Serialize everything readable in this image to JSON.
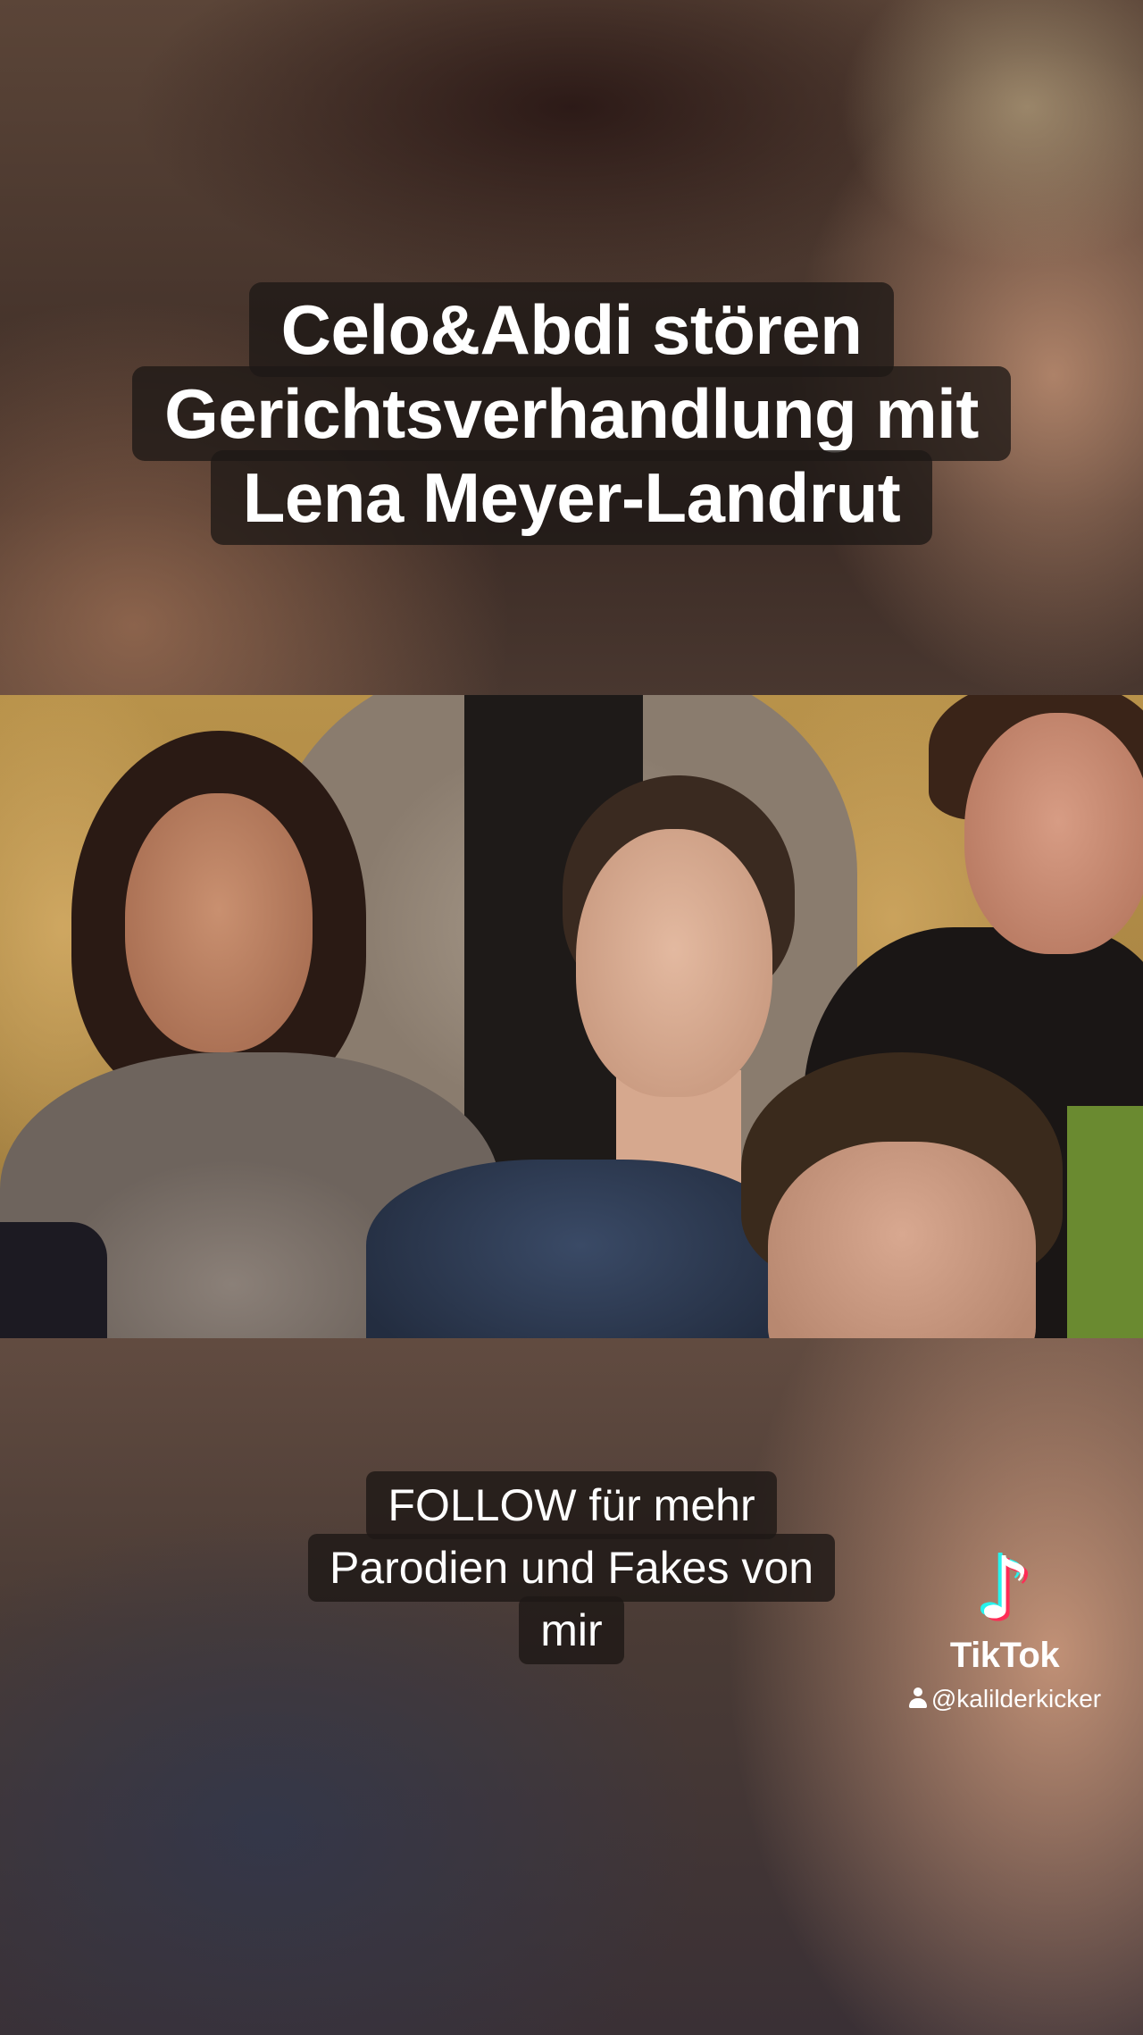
{
  "title": {
    "lines": [
      "Celo&Abdi stören",
      "Gerichtsverhandlung mit",
      "Lena Meyer-Landrut"
    ]
  },
  "caption": {
    "lines": [
      "FOLLOW für mehr",
      "Parodien und Fakes von",
      "mir"
    ]
  },
  "watermark": {
    "brand": "TikTok",
    "handle": "@kalilderkicker",
    "logo_icon": "tiktok-note-icon",
    "user_icon": "user-icon",
    "colors": {
      "cyan": "#25f4ee",
      "red": "#fe2c55",
      "white": "#ffffff"
    }
  }
}
